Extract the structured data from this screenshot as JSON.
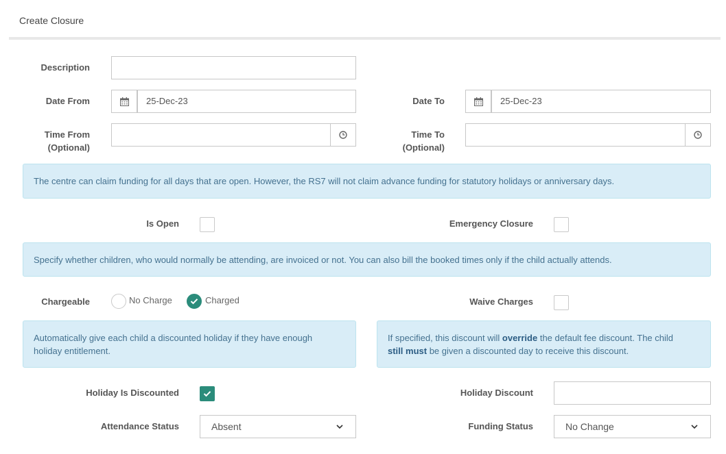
{
  "header": {
    "title": "Create Closure"
  },
  "form": {
    "description": {
      "label": "Description",
      "value": ""
    },
    "date_from": {
      "label": "Date From",
      "value": "25-Dec-23",
      "icon": "calendar-icon"
    },
    "date_to": {
      "label": "Date To",
      "value": "25-Dec-23",
      "icon": "calendar-icon"
    },
    "time_from": {
      "label_line1": "Time From",
      "label_line2": "(Optional)",
      "value": "",
      "icon": "clock-icon"
    },
    "time_to": {
      "label_line1": "Time To",
      "label_line2": "(Optional)",
      "value": "",
      "icon": "clock-icon"
    },
    "is_open": {
      "label": "Is Open",
      "checked": false
    },
    "emergency_closure": {
      "label": "Emergency Closure",
      "checked": false
    },
    "chargeable": {
      "label": "Chargeable",
      "options": [
        "No Charge",
        "Charged"
      ],
      "selected": "Charged"
    },
    "waive_charges": {
      "label": "Waive Charges",
      "checked": false
    },
    "holiday_is_discounted": {
      "label": "Holiday Is Discounted",
      "checked": true
    },
    "holiday_discount": {
      "label": "Holiday Discount",
      "value": ""
    },
    "attendance_status": {
      "label": "Attendance Status",
      "selected": "Absent"
    },
    "funding_status": {
      "label": "Funding Status",
      "selected": "No Change"
    }
  },
  "info": {
    "funding": "The centre can claim funding for all days that are open. However, the RS7 will not claim advance funding for statutory holidays or anniversary days.",
    "invoicing": "Specify whether children, who would normally be attending, are invoiced or not. You can also bill the booked times only if the child actually attends.",
    "discount_line1": "Automatically give each child a discounted holiday if they have enough",
    "discount_line2": "holiday entitlement.",
    "override_part1": "If specified, this discount will ",
    "override_bold1": "override",
    "override_part2": " the default fee discount. The child",
    "override_bold2": "still must",
    "override_part3": " be given a discounted day to receive this discount."
  },
  "colors": {
    "accent": "#2b8c7b",
    "info_bg": "#d9edf7",
    "info_text": "#44718f"
  }
}
